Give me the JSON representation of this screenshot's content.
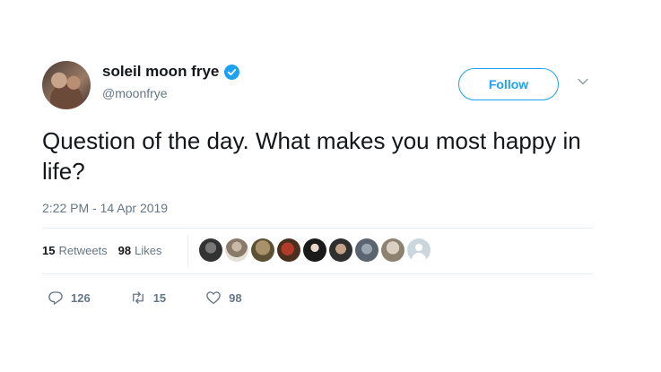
{
  "user": {
    "display_name": "soleil moon frye",
    "handle": "@moonfrye",
    "verified": true
  },
  "follow_button": {
    "label": "Follow"
  },
  "tweet": {
    "text": "Question of the day. What makes you most happy in life?",
    "timestamp": "2:22 PM - 14 Apr 2019"
  },
  "stats": {
    "retweets_count": "15",
    "retweets_label": "Retweets",
    "likes_count": "98",
    "likes_label": "Likes"
  },
  "likers": {
    "count_shown": 9
  },
  "actions": {
    "reply_count": "126",
    "retweet_count": "15",
    "like_count": "98"
  },
  "colors": {
    "accent": "#1da1f2",
    "text_primary": "#14171a",
    "text_secondary": "#657786",
    "divider": "#e6ecf0"
  },
  "icons": [
    "verified-badge-icon",
    "chevron-down-icon",
    "reply-icon",
    "retweet-icon",
    "heart-icon"
  ]
}
